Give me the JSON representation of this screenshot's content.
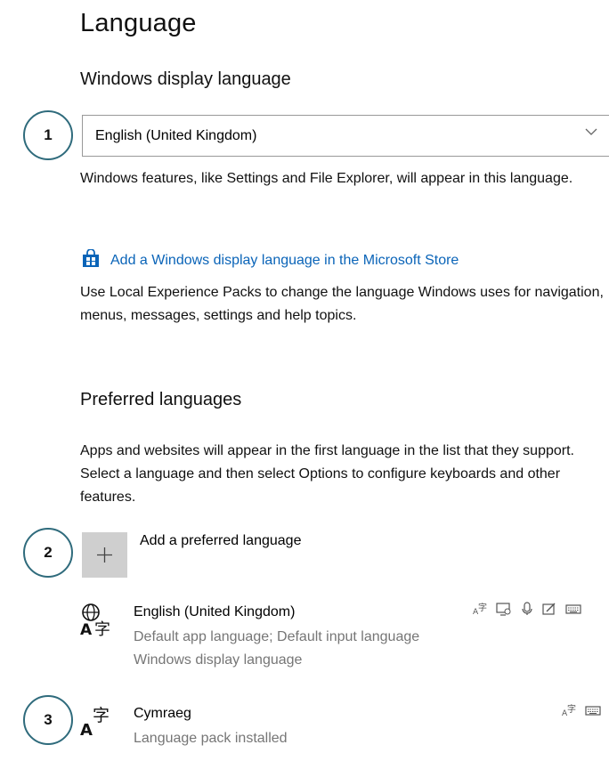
{
  "title": "Language",
  "display_language": {
    "heading": "Windows display language",
    "selected": "English (United Kingdom)",
    "description": "Windows features, like Settings and File Explorer, will appear in this language.",
    "store_link": "Add a Windows display language in the Microsoft Store",
    "lxp_text": "Use Local Experience Packs to change the language Windows uses for navigation, menus, messages, settings and help topics."
  },
  "preferred": {
    "heading": "Preferred languages",
    "description": "Apps and websites will appear in the first language in the list that they support. Select a language and then select Options to configure keyboards and other features.",
    "add_label": "Add a preferred language",
    "languages": [
      {
        "name": "English (United Kingdom)",
        "line1": "Default app language; Default input language",
        "line2": "Windows display language",
        "feature_icons": [
          "text-to-speech-icon",
          "display-language-icon",
          "speech-icon",
          "handwriting-icon",
          "keyboard-icon"
        ]
      },
      {
        "name": "Cymraeg",
        "line1": "Language pack installed",
        "feature_icons": [
          "text-to-speech-icon",
          "keyboard-icon"
        ]
      }
    ]
  },
  "callouts": [
    "1",
    "2",
    "3"
  ],
  "colors": {
    "link": "#0a64b8",
    "callout_border": "#2f6b7c",
    "add_tile": "#cfcfcf"
  }
}
